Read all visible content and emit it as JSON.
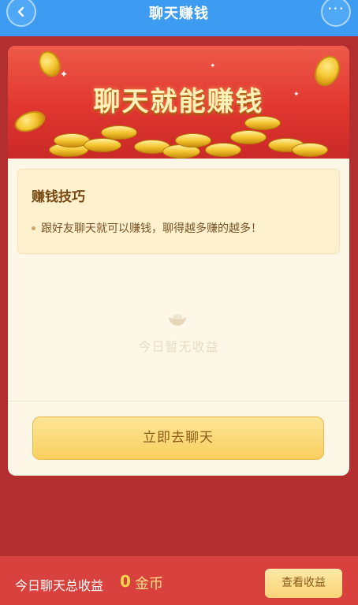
{
  "nav": {
    "title": "聊天赚钱",
    "back_icon": "chevron-left-icon",
    "more_icon": "more-dots-icon",
    "more_glyph": "···"
  },
  "banner": {
    "title": "聊天就能赚钱"
  },
  "tips": {
    "title": "赚钱技巧",
    "items": [
      "跟好友聊天就可以赚钱，聊得越多赚的越多！"
    ]
  },
  "empty_state": {
    "icon": "gold-ingot-icon",
    "text": "今日暂无收益"
  },
  "actions": {
    "chat_button": "立即去聊天"
  },
  "footer": {
    "total_label": "今日聊天总收益",
    "total_value": "0",
    "unit": "金币",
    "view_button": "查看收益"
  },
  "colors": {
    "nav_bg": "#3d9bf2",
    "page_bg": "#b32f2f",
    "footer_bg": "#d8413d",
    "gold": "#f6c935"
  }
}
